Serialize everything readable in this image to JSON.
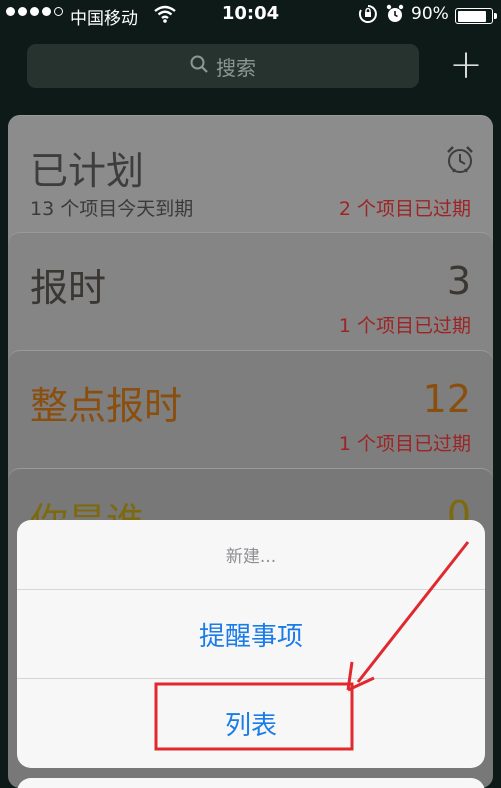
{
  "status_bar": {
    "carrier": "中国移动",
    "time": "10:04",
    "battery_percent": "90%",
    "battery_level": 0.9
  },
  "search": {
    "placeholder": "搜索",
    "icon": "search-icon"
  },
  "header": {
    "add_label": "+"
  },
  "lists": [
    {
      "title": "已计划",
      "subtitle": "13 个项目今天到期",
      "overdue": "2 个项目已过期",
      "icon": "alarm-clock-icon",
      "color": "#3d3d3d"
    },
    {
      "title": "报时",
      "count": "3",
      "overdue": "1 个项目已过期",
      "color": "#3a3631"
    },
    {
      "title": "整点报时",
      "count": "12",
      "overdue": "1 个项目已过期",
      "color": "#8a4f0e"
    },
    {
      "title": "你是谁",
      "count": "0",
      "color": "#7d6a0e"
    }
  ],
  "action_sheet": {
    "title": "新建...",
    "items": [
      "提醒事项",
      "列表"
    ]
  },
  "colors": {
    "accent": "#1a7ce8",
    "overdue": "#9c2424",
    "highlight": "#e0282e"
  }
}
